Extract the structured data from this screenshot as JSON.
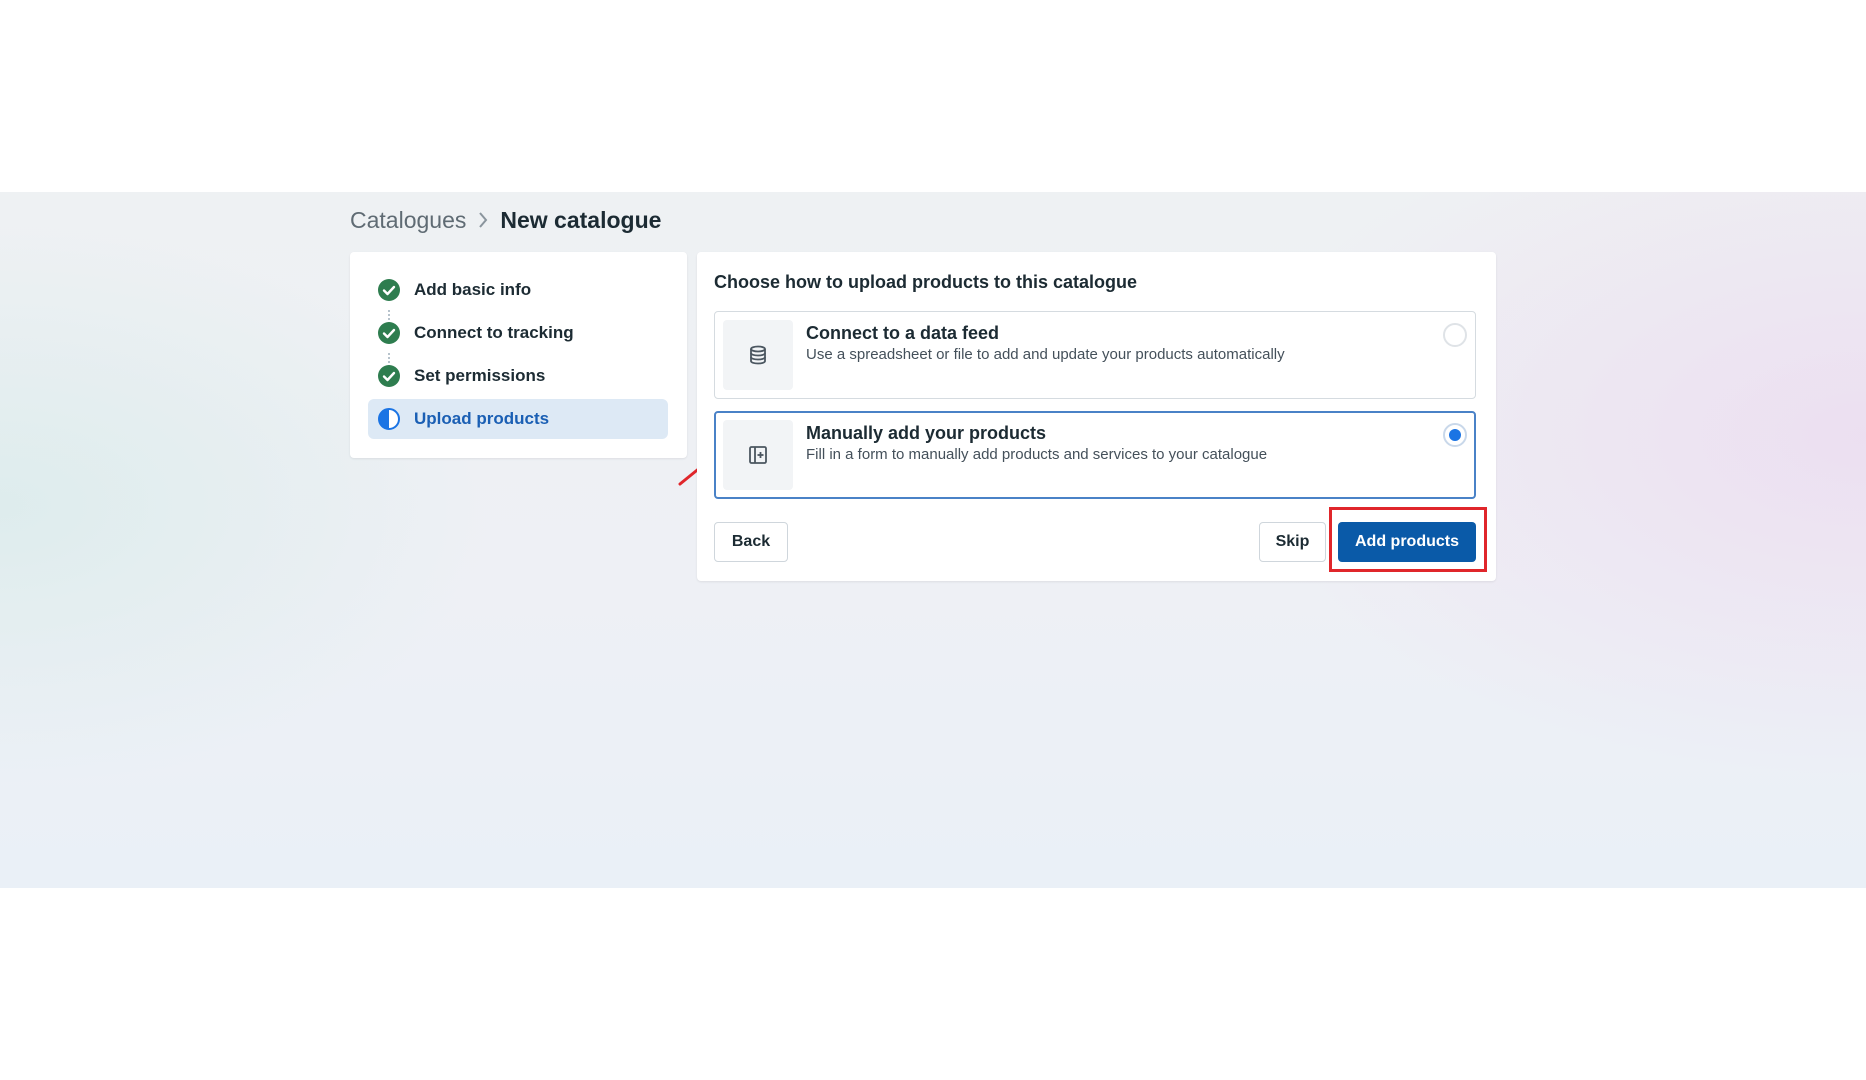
{
  "breadcrumb": {
    "parent": "Catalogues",
    "current": "New catalogue"
  },
  "steps": [
    {
      "label": "Add basic info",
      "status": "complete"
    },
    {
      "label": "Connect to tracking",
      "status": "complete"
    },
    {
      "label": "Set permissions",
      "status": "complete"
    },
    {
      "label": "Upload products",
      "status": "in-progress"
    }
  ],
  "main": {
    "title": "Choose how to upload products to this catalogue",
    "options": [
      {
        "title": "Connect to a data feed",
        "description": "Use a spreadsheet or file to add and update your products automatically",
        "icon": "database-icon",
        "selected": false
      },
      {
        "title": "Manually add your products",
        "description": "Fill in a form to manually add products and services to your catalogue",
        "icon": "add-item-icon",
        "selected": true
      }
    ],
    "buttons": {
      "back": "Back",
      "skip": "Skip",
      "add_products": "Add products"
    }
  },
  "colors": {
    "accent": "#1b74e4",
    "primary_button": "#0a5aa8",
    "complete_green": "#2e7d4f",
    "annotation_red": "#e0262b"
  }
}
